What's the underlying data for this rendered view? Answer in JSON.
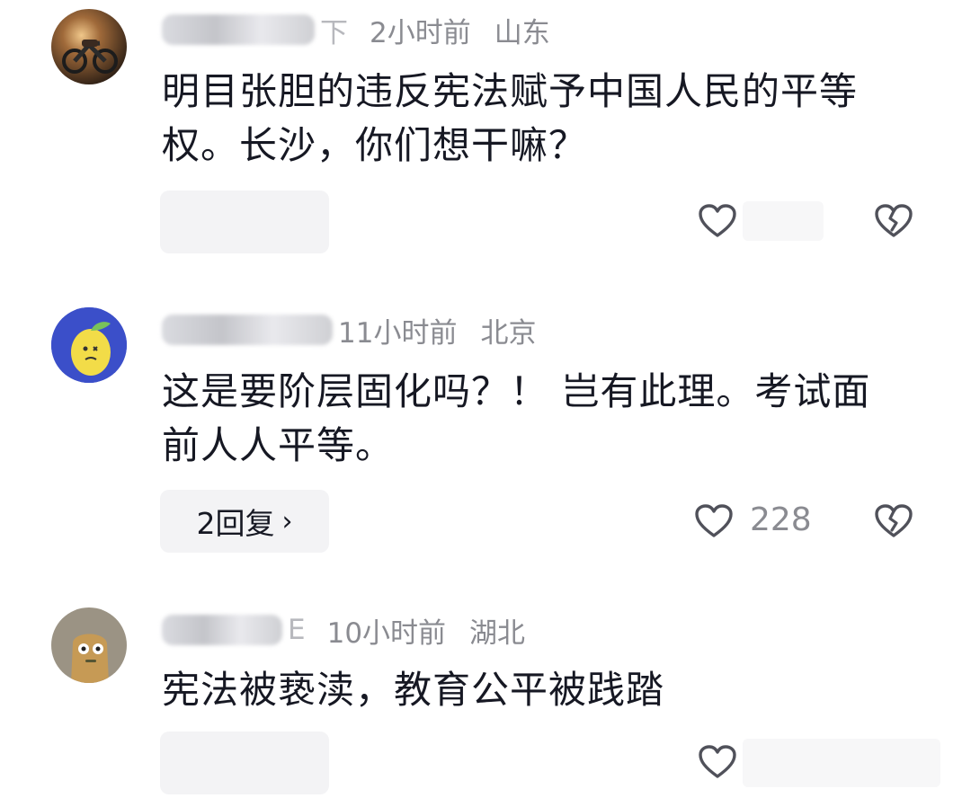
{
  "comments": [
    {
      "name_fragment": "下",
      "time": "2小时前",
      "location": "山东",
      "text": "明目张胆的违反宪法赋予中国人民的平等权。长沙，你们想干嘛？",
      "reply_label": "",
      "likes": ""
    },
    {
      "name_fragment": "",
      "time": "11小时前",
      "location": "北京",
      "text": "这是要阶层固化吗？！ 岂有此理。考试面前人人平等。",
      "reply_label": "2回复",
      "likes": "228"
    },
    {
      "name_fragment": "E",
      "time": "10小时前",
      "location": "湖北",
      "text": "宪法被亵渎，教育公平被践踏",
      "reply_label": "",
      "likes": ""
    }
  ],
  "icons": {
    "like": "heart-outline-icon",
    "dislike": "broken-heart-icon",
    "chevron": "chevron-right-icon"
  },
  "colors": {
    "text": "#161823",
    "meta": "#8a8b91",
    "reply_bg": "#f3f3f5",
    "avatar2_bg": "#3b4fc9",
    "lemon": "#f2dc48"
  },
  "glyphs": {
    "chevron": "›"
  }
}
